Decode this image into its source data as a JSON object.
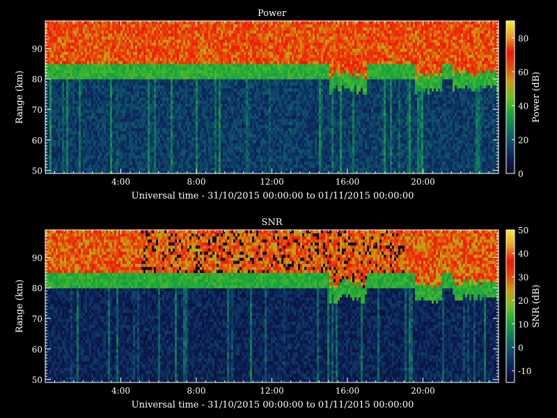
{
  "chart_data": [
    {
      "type": "heatmap",
      "title": "Power",
      "xlabel": "Universal time - 31/10/2015 00:00:00 to 01/11/2015 00:00:00",
      "ylabel": "Range (km)",
      "x_ticks": [
        "4:00",
        "8:00",
        "12:00",
        "16:00",
        "20:00"
      ],
      "x_tick_hours": [
        4,
        8,
        12,
        16,
        20
      ],
      "xlim_hours": [
        0,
        24
      ],
      "y_ticks": [
        50,
        60,
        70,
        80,
        90
      ],
      "ylim": [
        49,
        99
      ],
      "colorbar": {
        "label": "Power (dB)",
        "ticks": [
          0,
          20,
          40,
          60,
          80
        ],
        "range": [
          0,
          90
        ]
      },
      "profile": {
        "base_range_km": 81,
        "description_levels": {
          "below_80km": 15,
          "transition_80_86km": 38,
          "above_86km": 62
        }
      }
    },
    {
      "type": "heatmap",
      "title": "SNR",
      "xlabel": "Universal time - 31/10/2015 00:00:00 to 01/11/2015 00:00:00",
      "ylabel": "Range (km)",
      "x_ticks": [
        "4:00",
        "8:00",
        "12:00",
        "16:00",
        "20:00"
      ],
      "x_tick_hours": [
        4,
        8,
        12,
        16,
        20
      ],
      "xlim_hours": [
        0,
        24
      ],
      "y_ticks": [
        50,
        60,
        70,
        80,
        90
      ],
      "ylim": [
        49,
        99
      ],
      "colorbar": {
        "label": "SNR (dB)",
        "ticks": [
          -10,
          0,
          10,
          20,
          30,
          40,
          50
        ],
        "range": [
          -15,
          50
        ]
      },
      "profile": {
        "base_range_km": 81,
        "description_levels": {
          "below_80km": -8,
          "transition_80_86km": 12,
          "above_86km": 28
        }
      }
    }
  ],
  "colormap": [
    "#0a0a20",
    "#0c1f5a",
    "#0e4a6a",
    "#0f7a5a",
    "#18a83a",
    "#6fc020",
    "#c8a010",
    "#e84a08",
    "#f01408",
    "#f0a020",
    "#f8e830"
  ]
}
